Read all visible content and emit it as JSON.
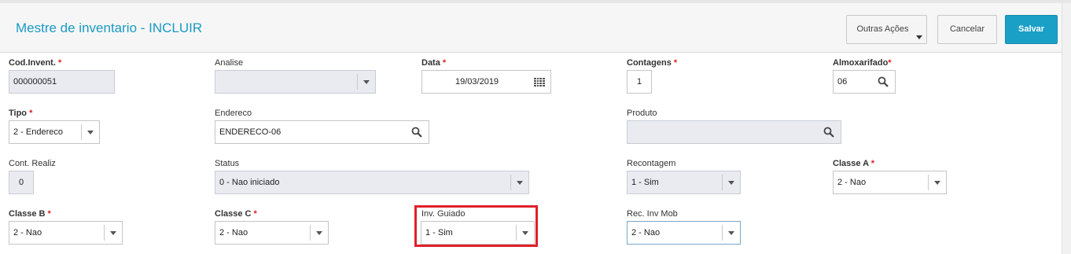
{
  "header": {
    "title": "Mestre de inventario - INCLUIR",
    "other_actions_label": "Outras Ações",
    "cancel_label": "Cancelar",
    "save_label": "Salvar"
  },
  "fields": {
    "cod_invent": {
      "label": "Cod.Invent.",
      "value": "000000051",
      "required": "*"
    },
    "analise": {
      "label": "Analise",
      "value": ""
    },
    "data": {
      "label": "Data",
      "value": "19/03/2019",
      "required": "*"
    },
    "contagens": {
      "label": "Contagens",
      "value": "1",
      "required": "*"
    },
    "almoxarifado": {
      "label": "Almoxarifado",
      "value": "06",
      "required": "*"
    },
    "tipo": {
      "label": "Tipo",
      "value": "2 - Endereco",
      "required": "*"
    },
    "endereco": {
      "label": "Endereco",
      "value": "ENDERECO-06"
    },
    "produto": {
      "label": "Produto",
      "value": ""
    },
    "cont_realiz": {
      "label": "Cont. Realiz",
      "value": "0"
    },
    "status": {
      "label": "Status",
      "value": "0 - Nao iniciado"
    },
    "recontagem": {
      "label": "Recontagem",
      "value": "1 - Sim"
    },
    "classe_a": {
      "label": "Classe A",
      "value": "2 - Nao",
      "required": "*"
    },
    "classe_b": {
      "label": "Classe B",
      "value": "2 - Nao",
      "required": "*"
    },
    "classe_c": {
      "label": "Classe C",
      "value": "2 - Nao",
      "required": "*"
    },
    "inv_guiado": {
      "label": "Inv. Guiado",
      "value": "1 - Sim"
    },
    "rec_inv_mob": {
      "label": "Rec. Inv Mob",
      "value": "2 - Nao"
    }
  },
  "colors": {
    "accent": "#1a9ac4",
    "save_button": "#1aa0c7",
    "highlight": "#e0202a",
    "disabled_field": "#e9ebf1"
  },
  "icons": {
    "search": "magnifier-icon",
    "calendar": "calendar-icon",
    "dropdown": "chevron-down-icon"
  }
}
